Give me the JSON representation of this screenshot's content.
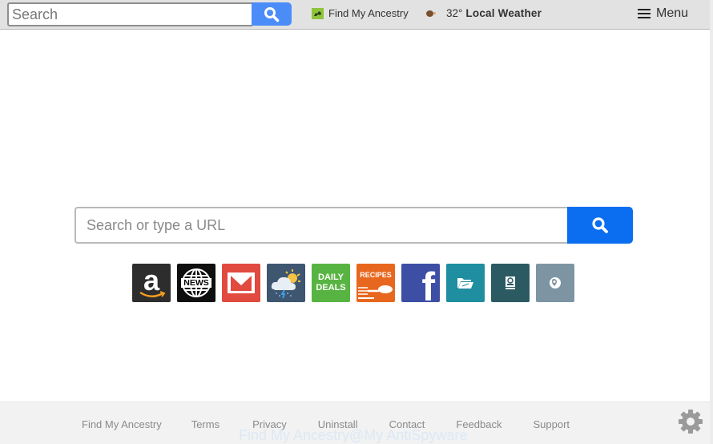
{
  "topbar": {
    "search_placeholder": "Search",
    "search_button_icon": "search-icon",
    "ancestry_link": "Find My Ancestry",
    "weather_temp": "32°",
    "weather_label": "Local Weather",
    "menu_label": "Menu"
  },
  "main": {
    "search_placeholder": "Search or type a URL",
    "search_button_icon": "search-icon",
    "tiles": [
      {
        "name": "amazon",
        "label": "a",
        "color": "#2d2d2d"
      },
      {
        "name": "news",
        "label": "NEWS",
        "color": "#0f0f0f"
      },
      {
        "name": "gmail",
        "label": "",
        "color": "#e14a3f"
      },
      {
        "name": "weather",
        "label": "",
        "color": "#3e5670"
      },
      {
        "name": "daily-deals",
        "label": "DAILY DEALS",
        "line1": "DAILY",
        "line2": "DEALS",
        "color": "#58b442"
      },
      {
        "name": "recipes",
        "label": "RECIPES",
        "color": "#e8671e"
      },
      {
        "name": "facebook",
        "label": "f",
        "color": "#3d4fa5"
      },
      {
        "name": "file-manager",
        "label": "",
        "color": "#1e8ea0"
      },
      {
        "name": "contacts",
        "label": "",
        "color": "#2c5a63"
      },
      {
        "name": "maps",
        "label": "",
        "color": "#7d95a3"
      }
    ]
  },
  "footer": {
    "links": [
      "Find My Ancestry",
      "Terms",
      "Privacy",
      "Uninstall",
      "Contact",
      "Feedback",
      "Support"
    ],
    "watermark": "Find My Ancestry@My AntiSpyware"
  }
}
